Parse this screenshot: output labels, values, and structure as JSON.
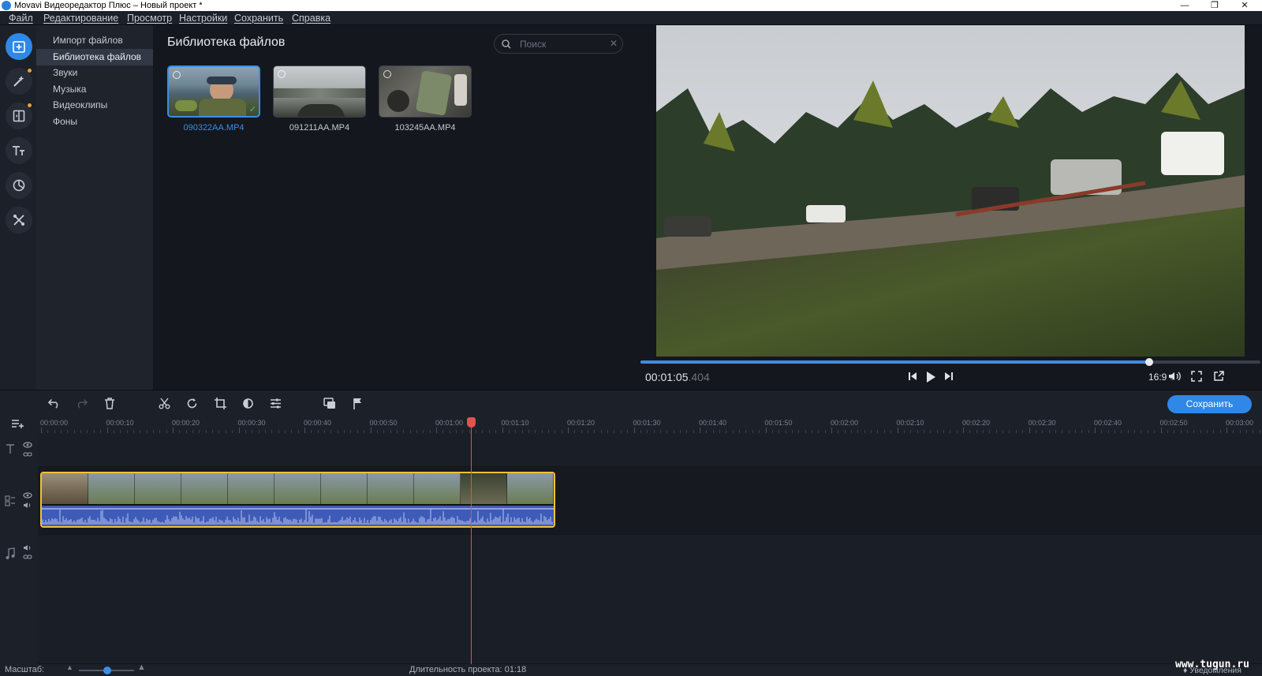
{
  "window": {
    "title": "Movavi Видеоредактор Плюс – Новый проект *",
    "controls": [
      "minimize-icon",
      "restore-icon",
      "close-icon"
    ]
  },
  "menu": [
    "Файл",
    "Редактирование",
    "Просмотр",
    "Настройки",
    "Сохранить",
    "Справка"
  ],
  "rail": {
    "tools": [
      "import-icon",
      "magic-wand-icon",
      "transitions-icon",
      "titles-icon",
      "stickers-icon",
      "tools-icon"
    ],
    "active": "import-icon"
  },
  "import_categories": {
    "items": [
      "Импорт файлов",
      "Библиотека файлов",
      "Звуки",
      "Музыка",
      "Видеоклипы",
      "Фоны"
    ],
    "selected": "Библиотека файлов"
  },
  "library": {
    "title": "Библиотека файлов",
    "search_placeholder": "Поиск",
    "files": [
      {
        "name": "090322AA.MP4",
        "selected": true
      },
      {
        "name": "091211AA.MP4",
        "selected": false
      },
      {
        "name": "103245AA.MP4",
        "selected": false
      }
    ]
  },
  "preview": {
    "timecode": "00:01:05",
    "timecode_ms": ".404",
    "aspect_ratio": "16:9",
    "progress": 0.82
  },
  "timeline": {
    "save_label": "Сохранить",
    "ruler_ticks": [
      "00:00:00",
      "00:00:10",
      "00:00:20",
      "00:00:30",
      "00:00:40",
      "00:00:50",
      "00:01:00",
      "00:01:10",
      "00:01:20",
      "00:01:30",
      "00:01:40",
      "00:01:50",
      "00:02:00",
      "00:02:10",
      "00:02:20",
      "00:02:30",
      "00:02:40",
      "00:02:50",
      "00:03:00"
    ],
    "playhead": "00:01:05"
  },
  "status": {
    "zoom_label": "Масштаб:",
    "duration_label": "Длительность проекта:",
    "duration_value": "01:18",
    "watermark": "www.tugun.ru",
    "notifications": "Уведомления"
  },
  "colors": {
    "accent": "#2f88e8",
    "clip_border": "#f1c232",
    "playhead": "#e0534f",
    "audio": "#3f5bb8"
  }
}
